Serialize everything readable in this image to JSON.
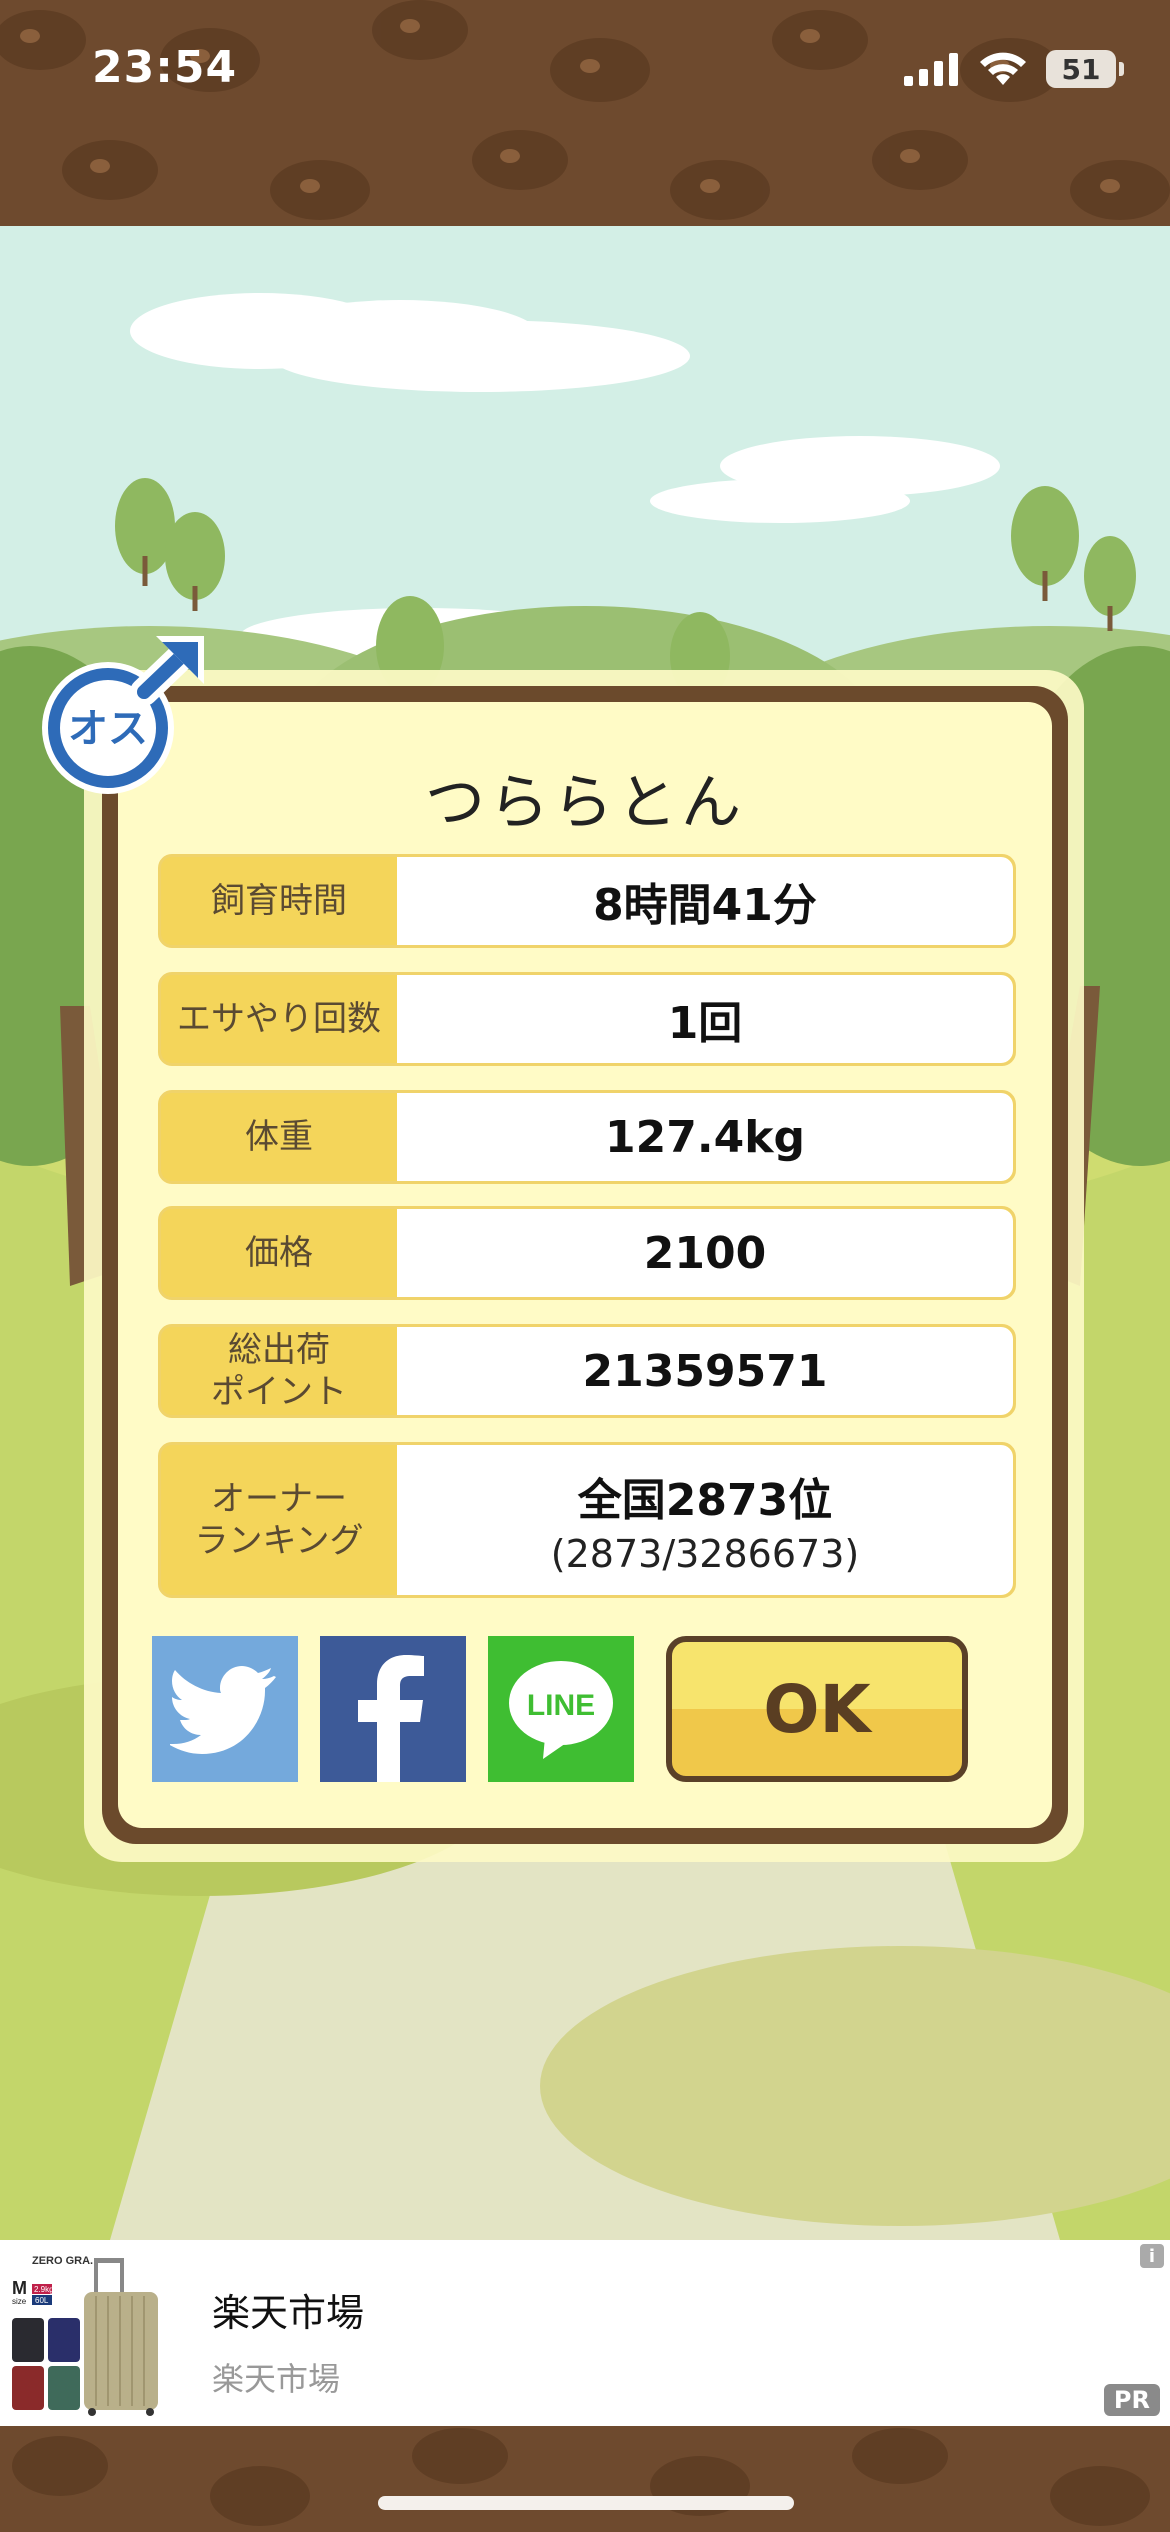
{
  "status_bar": {
    "time": "23:54",
    "battery": "51"
  },
  "gender_badge": {
    "text": "オス",
    "color": "#2e6bb8"
  },
  "pig": {
    "name": "つららとん"
  },
  "stats": [
    {
      "label": "飼育時間",
      "value": "8時間41分"
    },
    {
      "label": "エサやり回数",
      "value": "1回"
    },
    {
      "label": "体重",
      "value": "127.4kg"
    },
    {
      "label": "価格",
      "value": "2100"
    },
    {
      "label": "総出荷\nポイント",
      "value": "21359571"
    },
    {
      "label": "オーナー\nランキング",
      "value": "全国2873位",
      "sub": "(2873/3286673)"
    }
  ],
  "share": {
    "twitter": {
      "icon": "twitter-bird-icon",
      "color": "#74a9dc"
    },
    "facebook": {
      "icon": "facebook-f-icon",
      "color": "#3d5a98"
    },
    "line": {
      "icon": "line-icon",
      "text": "LINE",
      "color": "#3fbe32"
    }
  },
  "ok_button": {
    "label": "OK"
  },
  "ad": {
    "title": "楽天市場",
    "subtitle": "楽天市場",
    "badge": "PR",
    "info": "i",
    "product_lines": [
      "ZERO GRA.",
      "M",
      "size",
      "2.9kg",
      "60L"
    ]
  },
  "colors": {
    "brown": "#6b4a2c",
    "panel": "#fffbc6",
    "label_bg": "#f4d55a"
  }
}
